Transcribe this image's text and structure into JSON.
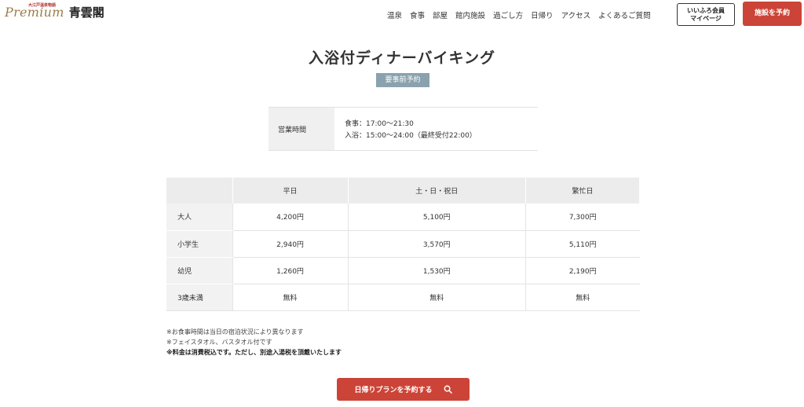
{
  "header": {
    "logo": {
      "premium": "Premium",
      "sub": "大江戸温泉物語",
      "name": "青雲閣"
    },
    "nav": [
      "温泉",
      "食事",
      "部屋",
      "館内施設",
      "過ごし方",
      "日帰り",
      "アクセス",
      "よくあるご質問"
    ],
    "member_button": {
      "line1": "いいふろ会員",
      "line2": "マイページ"
    },
    "reserve_button": "施設を予約"
  },
  "main": {
    "title": "入浴付ディナーバイキング",
    "badge": "要事前予約",
    "hours": {
      "label": "営業時間",
      "lines": [
        "食事：17:00～21:30",
        "入浴：15:00～24:00（最終受付22:00）"
      ]
    },
    "price_table": {
      "headers": [
        "",
        "平日",
        "土・日・祝日",
        "繁忙日"
      ],
      "rows": [
        {
          "label": "大人",
          "values": [
            "4,200円",
            "5,100円",
            "7,300円"
          ]
        },
        {
          "label": "小学生",
          "values": [
            "2,940円",
            "3,570円",
            "5,110円"
          ]
        },
        {
          "label": "幼児",
          "values": [
            "1,260円",
            "1,530円",
            "2,190円"
          ]
        },
        {
          "label": "3歳未満",
          "values": [
            "無料",
            "無料",
            "無料"
          ]
        }
      ]
    },
    "notes": [
      "※お食事時間は当日の宿泊状況により異なります",
      "※フェイスタオル、バスタオル付です",
      "※料金は消費税込です。ただし、別途入湯税を頂戴いたします"
    ],
    "cta_label": "日帰りプランを予約する",
    "cta_icon": "search-icon"
  },
  "colors": {
    "accent": "#cc4437",
    "badge": "#8aa2ad",
    "logo_gold": "#9a7d4c"
  }
}
